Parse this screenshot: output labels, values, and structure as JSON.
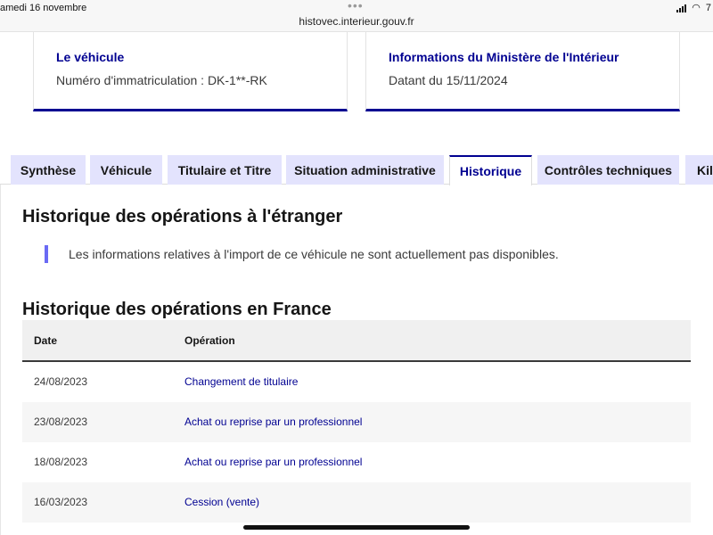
{
  "statusbar": {
    "date": "amedi 16 novembre",
    "dots": "•••",
    "url": "histovec.interieur.gouv.fr",
    "wifi_symbol": "◠",
    "battery_text": "7"
  },
  "cards": [
    {
      "title": "Le véhicule",
      "text": "Numéro d'immatriculation : DK-1**-RK"
    },
    {
      "title": "Informations du Ministère de l'Intérieur",
      "text": "Datant du 15/11/2024"
    }
  ],
  "tabs": [
    {
      "label": "Synthèse"
    },
    {
      "label": "Véhicule"
    },
    {
      "label": "Titulaire et Titre"
    },
    {
      "label": "Situation administrative"
    },
    {
      "label": "Historique"
    },
    {
      "label": "Contrôles techniques"
    },
    {
      "label": "Kilo"
    }
  ],
  "active_tab": "Historique",
  "foreign": {
    "heading": "Historique des opérations à l'étranger",
    "callout": "Les informations relatives à l'import de ce véhicule ne sont actuellement pas disponibles."
  },
  "france": {
    "heading": "Historique des opérations en France",
    "columns": [
      "Date",
      "Opération"
    ],
    "rows": [
      {
        "date": "24/08/2023",
        "operation": "Changement de titulaire"
      },
      {
        "date": "23/08/2023",
        "operation": "Achat ou reprise par un professionnel"
      },
      {
        "date": "18/08/2023",
        "operation": "Achat ou reprise par un professionnel"
      },
      {
        "date": "16/03/2023",
        "operation": "Cession (vente)"
      }
    ]
  },
  "colors": {
    "brand_blue": "#000091",
    "tab_bg": "#e3e3fd",
    "callout_bar": "#6a6af4"
  }
}
